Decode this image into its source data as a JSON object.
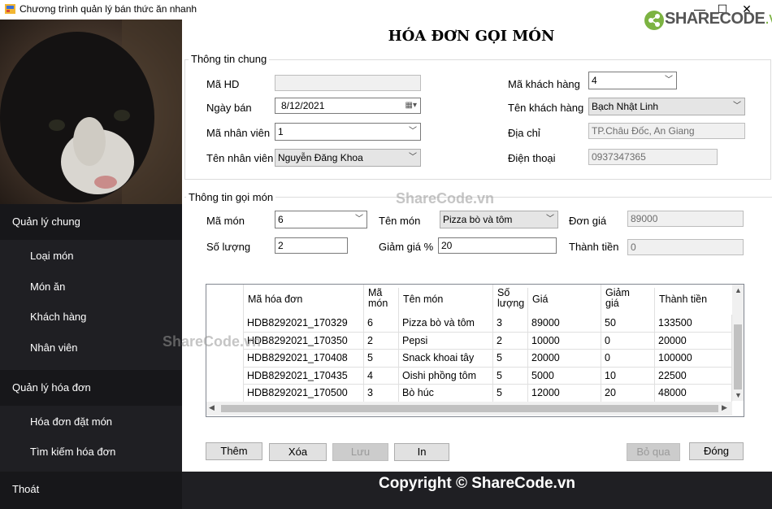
{
  "window": {
    "title": "Chương trình quản lý bán thức ăn nhanh",
    "minimize": "—",
    "maximize": "☐",
    "close": "✕"
  },
  "logo": {
    "text": "SHARECODE",
    "domain": ".vn"
  },
  "sidebar": {
    "groups": [
      {
        "label": "Quản lý chung",
        "items": [
          "Loại món",
          "Món ăn",
          "Khách hàng",
          "Nhân viên"
        ]
      },
      {
        "label": "Quản lý hóa đơn",
        "items": [
          "Hóa đơn đặt món",
          "Tìm kiếm hóa đơn"
        ]
      },
      {
        "label": "Thoát",
        "items": []
      }
    ]
  },
  "form": {
    "title": "HÓA ĐƠN GỌI MÓN",
    "general": {
      "legend": "Thông tin chung",
      "ma_hd_label": "Mã HD",
      "ma_hd_value": "",
      "ngay_ban_label": "Ngày bán",
      "ngay_ban_value": "8/12/2021",
      "ma_nv_label": "Mã nhân viên",
      "ma_nv_value": "1",
      "ten_nv_label": "Tên nhân viên",
      "ten_nv_value": "Nguyễn Đăng Khoa",
      "ma_kh_label": "Mã khách hàng",
      "ma_kh_value": "4",
      "ten_kh_label": "Tên khách hàng",
      "ten_kh_value": "Bạch Nhật Linh",
      "dia_chi_label": "Địa chỉ",
      "dia_chi_value": "TP.Châu Đốc, An Giang",
      "dien_thoai_label": "Điện thoại",
      "dien_thoai_value": "0937347365"
    },
    "order": {
      "legend": "Thông tin gọi món",
      "ma_mon_label": "Mã món",
      "ma_mon_value": "6",
      "ten_mon_label": "Tên món",
      "ten_mon_value": "Pizza bò và tôm",
      "don_gia_label": "Đơn giá",
      "don_gia_value": "89000",
      "so_luong_label": "Số lượng",
      "so_luong_value": "2",
      "giam_gia_label": "Giảm giá %",
      "giam_gia_value": "20",
      "thanh_tien_label": "Thành tiền",
      "thanh_tien_value": "0"
    },
    "grid": {
      "columns": [
        "Mã hóa đơn",
        "Mã\nmón",
        "Tên món",
        "Số\nlượng",
        "Giá",
        "Giảm\ngiá",
        "Thành tiền"
      ],
      "rows": [
        [
          "HDB8292021_170329",
          "6",
          "Pizza bò và tôm",
          "3",
          "89000",
          "50",
          "133500"
        ],
        [
          "HDB8292021_170350",
          "2",
          "Pepsi",
          "2",
          "10000",
          "0",
          "20000"
        ],
        [
          "HDB8292021_170408",
          "5",
          "Snack khoai tây",
          "5",
          "20000",
          "0",
          "100000"
        ],
        [
          "HDB8292021_170435",
          "4",
          "Oishi phồng tôm",
          "5",
          "5000",
          "10",
          "22500"
        ],
        [
          "HDB8292021_170500",
          "3",
          "Bò húc",
          "5",
          "12000",
          "20",
          "48000"
        ]
      ]
    },
    "buttons": {
      "them": "Thêm",
      "xoa": "Xóa",
      "luu": "Lưu",
      "in": "In",
      "bo_qua": "Bỏ qua",
      "dong": "Đóng"
    }
  },
  "watermarks": {
    "center": "ShareCode.vn",
    "left": "ShareCode.vn",
    "bottom": "Copyright © ShareCode.vn"
  },
  "colors": {
    "sidebar_bg": "#1f1f23",
    "sidebar_group_bg": "#17171a",
    "logo_green": "#7cb342"
  }
}
